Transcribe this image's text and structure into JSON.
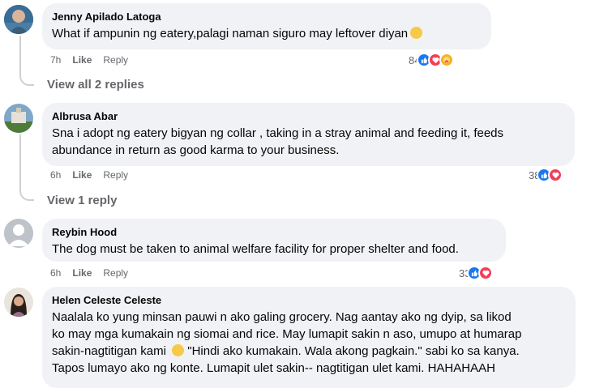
{
  "comments": [
    {
      "author": "Jenny Apilado Latoga",
      "text": "What if ampunin ng eatery,palagi naman siguro may leftover diyan",
      "time": "7h",
      "like_label": "Like",
      "reply_label": "Reply",
      "reaction_count": "84",
      "reactions": [
        "like",
        "love",
        "care"
      ],
      "view_replies": "View all 2 replies"
    },
    {
      "author": "Albrusa Abar",
      "text_lines": [
        "Sna i adopt ng eatery bigyan ng collar , taking in a stray animal and feeding it, feeds",
        "abundance in return as good karma to your business."
      ],
      "time": "6h",
      "like_label": "Like",
      "reply_label": "Reply",
      "reaction_count": "38",
      "reactions": [
        "like",
        "love"
      ],
      "view_replies": "View 1 reply"
    },
    {
      "author": "Reybin Hood",
      "text": "The dog must be taken to animal welfare facility for proper shelter and food.",
      "time": "6h",
      "like_label": "Like",
      "reply_label": "Reply",
      "reaction_count": "33",
      "reactions": [
        "like",
        "love"
      ]
    },
    {
      "author": "Helen Celeste Celeste",
      "text_lines": [
        "Naalala ko yung minsan pauwi n ako galing grocery. Nag aantay ako ng dyip, sa likod",
        "ko may mga kumakain ng siomai and rice. May lumapit sakin n aso, umupo at humarap",
        "sakin-nagtitigan kami",
        "\"Hindi ako kumakain. Wala akong pagkain.\" sabi ko sa kanya.",
        "Tapos lumayo ako ng konte. Lumapit ulet sakin-- nagtitigan ulet kami. HAHAHAAH"
      ]
    }
  ],
  "colors": {
    "bubble": "#f0f2f5",
    "meta": "#65676b",
    "like": "#1877f2",
    "love": "#f33e58",
    "care": "#f7b125"
  }
}
